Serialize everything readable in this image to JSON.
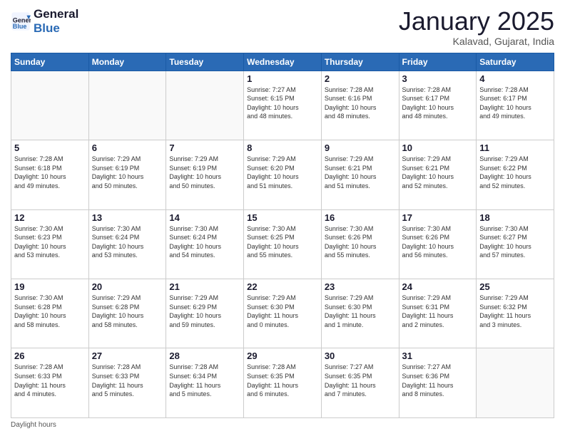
{
  "header": {
    "logo_line1": "General",
    "logo_line2": "Blue",
    "month_title": "January 2025",
    "location": "Kalavad, Gujarat, India"
  },
  "days_of_week": [
    "Sunday",
    "Monday",
    "Tuesday",
    "Wednesday",
    "Thursday",
    "Friday",
    "Saturday"
  ],
  "weeks": [
    [
      {
        "day": "",
        "info": ""
      },
      {
        "day": "",
        "info": ""
      },
      {
        "day": "",
        "info": ""
      },
      {
        "day": "1",
        "info": "Sunrise: 7:27 AM\nSunset: 6:15 PM\nDaylight: 10 hours\nand 48 minutes."
      },
      {
        "day": "2",
        "info": "Sunrise: 7:28 AM\nSunset: 6:16 PM\nDaylight: 10 hours\nand 48 minutes."
      },
      {
        "day": "3",
        "info": "Sunrise: 7:28 AM\nSunset: 6:17 PM\nDaylight: 10 hours\nand 48 minutes."
      },
      {
        "day": "4",
        "info": "Sunrise: 7:28 AM\nSunset: 6:17 PM\nDaylight: 10 hours\nand 49 minutes."
      }
    ],
    [
      {
        "day": "5",
        "info": "Sunrise: 7:28 AM\nSunset: 6:18 PM\nDaylight: 10 hours\nand 49 minutes."
      },
      {
        "day": "6",
        "info": "Sunrise: 7:29 AM\nSunset: 6:19 PM\nDaylight: 10 hours\nand 50 minutes."
      },
      {
        "day": "7",
        "info": "Sunrise: 7:29 AM\nSunset: 6:19 PM\nDaylight: 10 hours\nand 50 minutes."
      },
      {
        "day": "8",
        "info": "Sunrise: 7:29 AM\nSunset: 6:20 PM\nDaylight: 10 hours\nand 51 minutes."
      },
      {
        "day": "9",
        "info": "Sunrise: 7:29 AM\nSunset: 6:21 PM\nDaylight: 10 hours\nand 51 minutes."
      },
      {
        "day": "10",
        "info": "Sunrise: 7:29 AM\nSunset: 6:21 PM\nDaylight: 10 hours\nand 52 minutes."
      },
      {
        "day": "11",
        "info": "Sunrise: 7:29 AM\nSunset: 6:22 PM\nDaylight: 10 hours\nand 52 minutes."
      }
    ],
    [
      {
        "day": "12",
        "info": "Sunrise: 7:30 AM\nSunset: 6:23 PM\nDaylight: 10 hours\nand 53 minutes."
      },
      {
        "day": "13",
        "info": "Sunrise: 7:30 AM\nSunset: 6:24 PM\nDaylight: 10 hours\nand 53 minutes."
      },
      {
        "day": "14",
        "info": "Sunrise: 7:30 AM\nSunset: 6:24 PM\nDaylight: 10 hours\nand 54 minutes."
      },
      {
        "day": "15",
        "info": "Sunrise: 7:30 AM\nSunset: 6:25 PM\nDaylight: 10 hours\nand 55 minutes."
      },
      {
        "day": "16",
        "info": "Sunrise: 7:30 AM\nSunset: 6:26 PM\nDaylight: 10 hours\nand 55 minutes."
      },
      {
        "day": "17",
        "info": "Sunrise: 7:30 AM\nSunset: 6:26 PM\nDaylight: 10 hours\nand 56 minutes."
      },
      {
        "day": "18",
        "info": "Sunrise: 7:30 AM\nSunset: 6:27 PM\nDaylight: 10 hours\nand 57 minutes."
      }
    ],
    [
      {
        "day": "19",
        "info": "Sunrise: 7:30 AM\nSunset: 6:28 PM\nDaylight: 10 hours\nand 58 minutes."
      },
      {
        "day": "20",
        "info": "Sunrise: 7:29 AM\nSunset: 6:28 PM\nDaylight: 10 hours\nand 58 minutes."
      },
      {
        "day": "21",
        "info": "Sunrise: 7:29 AM\nSunset: 6:29 PM\nDaylight: 10 hours\nand 59 minutes."
      },
      {
        "day": "22",
        "info": "Sunrise: 7:29 AM\nSunset: 6:30 PM\nDaylight: 11 hours\nand 0 minutes."
      },
      {
        "day": "23",
        "info": "Sunrise: 7:29 AM\nSunset: 6:30 PM\nDaylight: 11 hours\nand 1 minute."
      },
      {
        "day": "24",
        "info": "Sunrise: 7:29 AM\nSunset: 6:31 PM\nDaylight: 11 hours\nand 2 minutes."
      },
      {
        "day": "25",
        "info": "Sunrise: 7:29 AM\nSunset: 6:32 PM\nDaylight: 11 hours\nand 3 minutes."
      }
    ],
    [
      {
        "day": "26",
        "info": "Sunrise: 7:28 AM\nSunset: 6:33 PM\nDaylight: 11 hours\nand 4 minutes."
      },
      {
        "day": "27",
        "info": "Sunrise: 7:28 AM\nSunset: 6:33 PM\nDaylight: 11 hours\nand 5 minutes."
      },
      {
        "day": "28",
        "info": "Sunrise: 7:28 AM\nSunset: 6:34 PM\nDaylight: 11 hours\nand 5 minutes."
      },
      {
        "day": "29",
        "info": "Sunrise: 7:28 AM\nSunset: 6:35 PM\nDaylight: 11 hours\nand 6 minutes."
      },
      {
        "day": "30",
        "info": "Sunrise: 7:27 AM\nSunset: 6:35 PM\nDaylight: 11 hours\nand 7 minutes."
      },
      {
        "day": "31",
        "info": "Sunrise: 7:27 AM\nSunset: 6:36 PM\nDaylight: 11 hours\nand 8 minutes."
      },
      {
        "day": "",
        "info": ""
      }
    ]
  ],
  "footer": {
    "note": "Daylight hours"
  }
}
